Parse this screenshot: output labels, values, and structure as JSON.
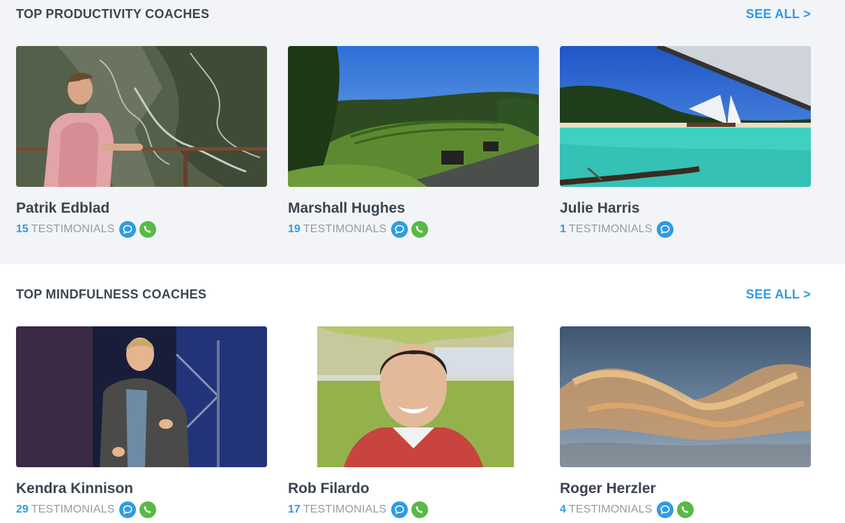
{
  "productivity": {
    "title": "TOP PRODUCTIVITY COACHES",
    "see_all": "SEE ALL >",
    "coaches": [
      {
        "name": "Patrik Edblad",
        "count": "15",
        "testimonials_label": "TESTIMONIALS",
        "chat": true,
        "phone": true
      },
      {
        "name": "Marshall Hughes",
        "count": "19",
        "testimonials_label": "TESTIMONIALS",
        "chat": true,
        "phone": true
      },
      {
        "name": "Julie Harris",
        "count": "1",
        "testimonials_label": "TESTIMONIALS",
        "chat": true,
        "phone": false
      }
    ]
  },
  "mindfulness": {
    "title": "TOP MINDFULNESS COACHES",
    "see_all": "SEE ALL >",
    "coaches": [
      {
        "name": "Kendra Kinnison",
        "count": "29",
        "testimonials_label": "TESTIMONIALS",
        "chat": true,
        "phone": true
      },
      {
        "name": "Rob Filardo",
        "count": "17",
        "testimonials_label": "TESTIMONIALS",
        "chat": true,
        "phone": true
      },
      {
        "name": "Roger Herzler",
        "count": "4",
        "testimonials_label": "TESTIMONIALS",
        "chat": true,
        "phone": true
      }
    ]
  },
  "icons": {
    "chat": "chat-bubble-icon",
    "phone": "phone-icon"
  },
  "colors": {
    "accent": "#2f9be6",
    "phone_green": "#58b947",
    "section_bg": "#f2f4f7",
    "heading": "#3c4651",
    "muted": "#939ba4"
  }
}
